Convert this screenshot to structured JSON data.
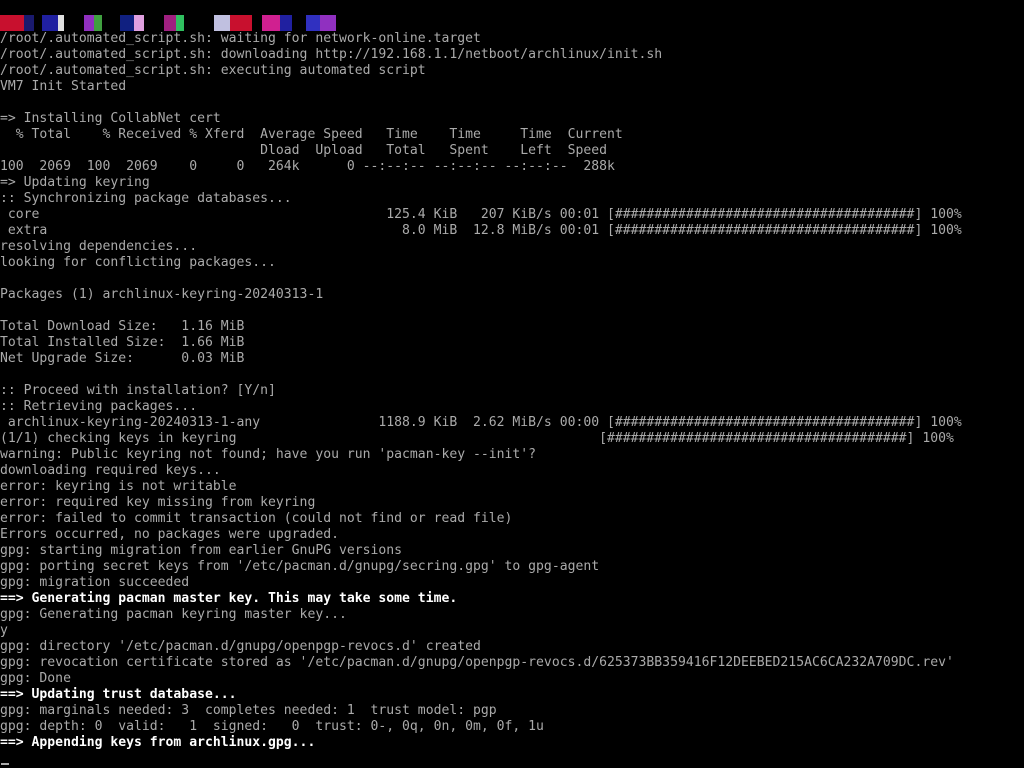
{
  "screen": {
    "background": "#000000",
    "text_color": "#aaaaaa",
    "bright_color": "#ffffff"
  },
  "glitch_colors": [
    "#c8102e",
    "#1a1a6e",
    "#d02090",
    "#2020a0",
    "#e0e0e0",
    "#3030c0",
    "#9030c0",
    "#40a040",
    "#c0c0c0",
    "#102080",
    "#e0a0e0",
    "#20a0e0",
    "#a02080",
    "#30c060",
    "#2040d0",
    "#c0c0e0"
  ],
  "lines": [
    {
      "text": "/root/.automated_script.sh: waiting for network-online.target"
    },
    {
      "text": "/root/.automated_script.sh: downloading http://192.168.1.1/netboot/archlinux/init.sh"
    },
    {
      "text": "/root/.automated_script.sh: executing automated script"
    },
    {
      "text": "VM7 Init Started"
    },
    {
      "text": ""
    },
    {
      "text": "=> Installing CollabNet cert"
    },
    {
      "text": "  % Total    % Received % Xferd  Average Speed   Time    Time     Time  Current"
    },
    {
      "text": "                                 Dload  Upload   Total   Spent    Left  Speed"
    },
    {
      "text": "100  2069  100  2069    0     0   264k      0 --:--:-- --:--:-- --:--:--  288k"
    },
    {
      "text": "=> Updating keyring"
    },
    {
      "text": ":: Synchronizing package databases..."
    },
    {
      "text": " core                                            125.4 KiB   207 KiB/s 00:01 [######################################] 100%"
    },
    {
      "text": " extra                                             8.0 MiB  12.8 MiB/s 00:01 [######################################] 100%"
    },
    {
      "text": "resolving dependencies..."
    },
    {
      "text": "looking for conflicting packages..."
    },
    {
      "text": ""
    },
    {
      "text": "Packages (1) archlinux-keyring-20240313-1"
    },
    {
      "text": ""
    },
    {
      "text": "Total Download Size:   1.16 MiB"
    },
    {
      "text": "Total Installed Size:  1.66 MiB"
    },
    {
      "text": "Net Upgrade Size:      0.03 MiB"
    },
    {
      "text": ""
    },
    {
      "text": ":: Proceed with installation? [Y/n]"
    },
    {
      "text": ":: Retrieving packages..."
    },
    {
      "text": " archlinux-keyring-20240313-1-any               1188.9 KiB  2.62 MiB/s 00:00 [######################################] 100%"
    },
    {
      "text": "(1/1) checking keys in keyring                                              [######################################] 100%"
    },
    {
      "text": "warning: Public keyring not found; have you run 'pacman-key --init'?"
    },
    {
      "text": "downloading required keys..."
    },
    {
      "text": "error: keyring is not writable"
    },
    {
      "text": "error: required key missing from keyring"
    },
    {
      "text": "error: failed to commit transaction (could not find or read file)"
    },
    {
      "text": "Errors occurred, no packages were upgraded."
    },
    {
      "text": "gpg: starting migration from earlier GnuPG versions"
    },
    {
      "text": "gpg: porting secret keys from '/etc/pacman.d/gnupg/secring.gpg' to gpg-agent"
    },
    {
      "text": "gpg: migration succeeded"
    },
    {
      "text": "==> Generating pacman master key. This may take some time.",
      "bright": true
    },
    {
      "text": "gpg: Generating pacman keyring master key..."
    },
    {
      "text": "y"
    },
    {
      "text": "gpg: directory '/etc/pacman.d/gnupg/openpgp-revocs.d' created"
    },
    {
      "text": "gpg: revocation certificate stored as '/etc/pacman.d/gnupg/openpgp-revocs.d/625373BB359416F12DEEBED215AC6CA232A709DC.rev'"
    },
    {
      "text": "gpg: Done"
    },
    {
      "text": "==> Updating trust database...",
      "bright": true
    },
    {
      "text": "gpg: marginals needed: 3  completes needed: 1  trust model: pgp"
    },
    {
      "text": "gpg: depth: 0  valid:   1  signed:   0  trust: 0-, 0q, 0n, 0m, 0f, 1u"
    },
    {
      "text": "==> Appending keys from archlinux.gpg...",
      "bright": true
    }
  ]
}
